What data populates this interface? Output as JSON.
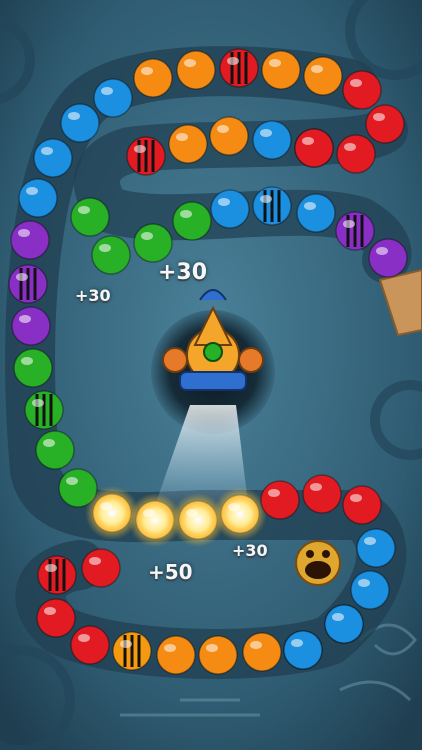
{
  "game": {
    "type": "marble-shooter",
    "colors": {
      "orange": "#f58b12",
      "red": "#e21b22",
      "blue": "#1b8fe0",
      "green": "#28b027",
      "purple": "#8a2fc5",
      "yellow-bomb": "#f59a10",
      "background": "#2f5a70",
      "track": "#29485c"
    },
    "score_popups": [
      {
        "text": "+30"
      },
      {
        "text": "+30"
      },
      {
        "text": "+50"
      },
      {
        "text": "+30"
      }
    ],
    "shooter": {
      "loaded_ball": "green"
    },
    "chain_top": [
      "orange",
      "orange",
      "red-striped",
      "orange",
      "orange",
      "red",
      "red",
      "red"
    ],
    "chain_second": [
      "blue",
      "blue",
      "blue",
      "blue",
      "orange",
      "orange",
      "red-striped",
      "blue",
      "blue",
      "red"
    ],
    "chain_third": [
      "green",
      "green",
      "green",
      "green",
      "blue",
      "blue-striped",
      "blue",
      "purple-striped",
      "purple"
    ],
    "chain_left": [
      "purple",
      "purple-striped",
      "purple",
      "green",
      "green-striped",
      "green",
      "green"
    ],
    "chain_bottom": [
      "exploding",
      "exploding",
      "exploding",
      "exploding",
      "red",
      "red",
      "red",
      "blue",
      "blue",
      "blue",
      "blue"
    ],
    "chain_bottom_row": [
      "red-striped",
      "red",
      "red",
      "red",
      "yellow-striped",
      "orange",
      "orange",
      "orange",
      "blue",
      "blue"
    ]
  }
}
